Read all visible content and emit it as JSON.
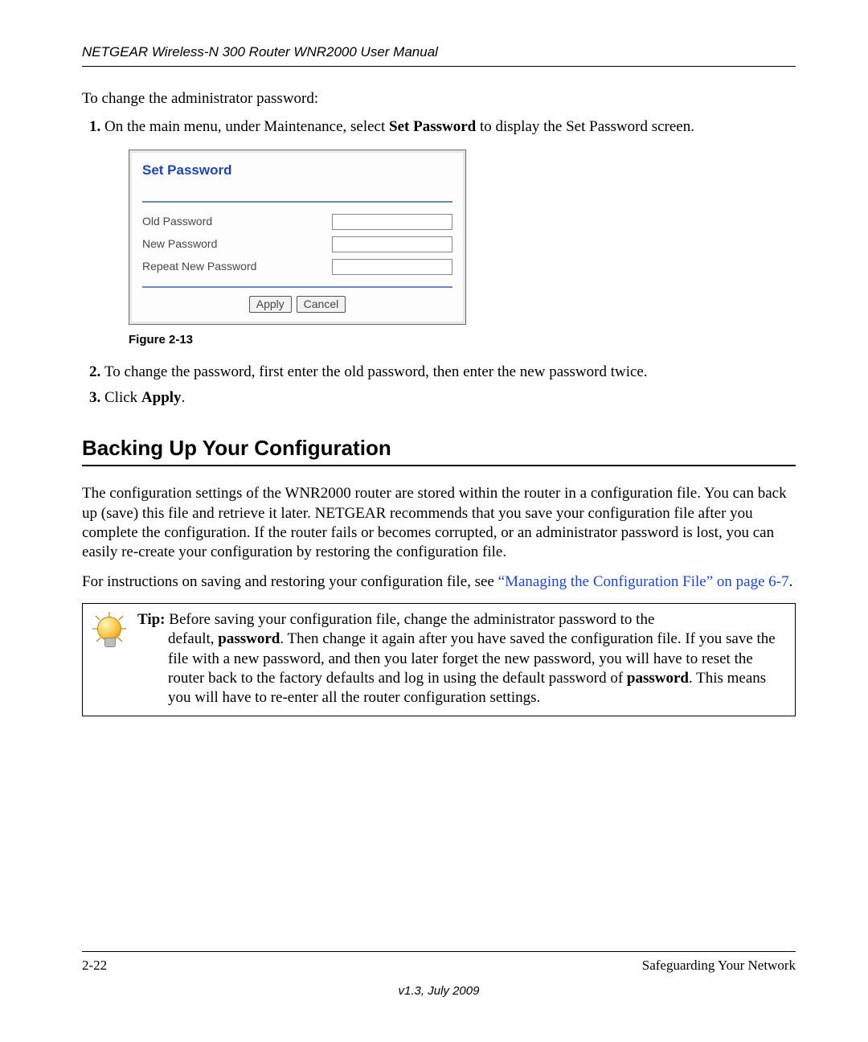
{
  "header": "NETGEAR Wireless-N 300 Router WNR2000 User Manual",
  "intro": "To change the administrator password:",
  "steps": {
    "s1_pre": "On the main menu, under Maintenance, select ",
    "s1_bold": "Set Password",
    "s1_post": " to display the Set Password screen.",
    "s2": "To change the password, first enter the old password, then enter the new password twice.",
    "s3_pre": "Click ",
    "s3_bold": "Apply",
    "s3_post": "."
  },
  "figure": {
    "title": "Set Password",
    "rows": [
      "Old Password",
      "New Password",
      "Repeat New Password"
    ],
    "apply": "Apply",
    "cancel": "Cancel",
    "caption": "Figure 2-13"
  },
  "section_heading": "Backing Up Your Configuration",
  "para1": "The configuration settings of the WNR2000 router are stored within the router in a configuration file. You can back up (save) this file and retrieve it later. NETGEAR recommends that you save your configuration file after you complete the configuration. If the router fails or becomes corrupted, or an administrator password is lost, you can easily re-create your configuration by restoring the configuration file.",
  "para2_pre": "For instructions on saving and restoring your configuration file, see ",
  "para2_link": "“Managing the Configuration File” on page 6-7",
  "para2_post": ".",
  "tip": {
    "label": "Tip:",
    "line1": " Before saving your configuration file, change the administrator password to the",
    "line2a": "default, ",
    "line2b": "password",
    "line2c": ". Then change it again after you have saved the configuration file. If you save the file with a new password, and then you later forget the new password, you will have to reset the router back to the factory defaults and log in using the default password of ",
    "line2d": "password",
    "line2e": ". This means you will have to re-enter all the router configuration settings."
  },
  "footer": {
    "page": "2-22",
    "chapter": "Safeguarding Your Network",
    "version": "v1.3, July 2009"
  }
}
